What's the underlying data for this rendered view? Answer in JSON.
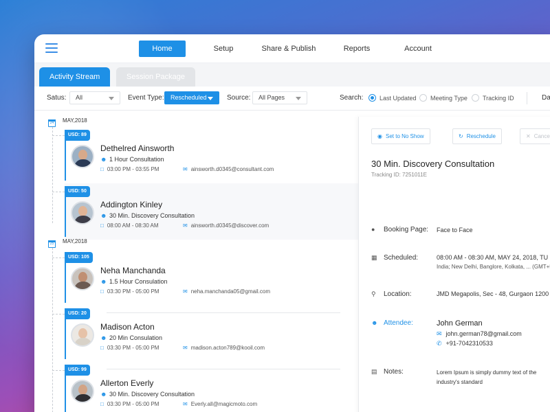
{
  "nav": {
    "items": [
      "Home",
      "Setup",
      "Share & Publish",
      "Reports",
      "Account"
    ],
    "active": "Home"
  },
  "tabs": [
    "Activity Stream",
    "Session Package"
  ],
  "filters": {
    "status_label": "Satus:",
    "status_value": "All",
    "event_type_label": "Event Type:",
    "event_type_value": "Rescheduled",
    "source_label": "Source:",
    "source_value": "All Pages",
    "search_label": "Search:",
    "search_options": [
      "Last Updated",
      "Meeting Type",
      "Tracking ID"
    ],
    "search_selected": "Last Updated",
    "overflow_label": "Da"
  },
  "stream": {
    "groups": [
      {
        "date_icon": "24",
        "date": "MAY,2018",
        "entries": [
          {
            "badge": "USD: 89",
            "name": "Dethelred Ainsworth",
            "service": "1 Hour Consultation",
            "time": "03:00 PM - 03:55 PM",
            "email": "ainsworth.d0345@consultant.com"
          },
          {
            "badge": "USD: 50",
            "name": "Addington Kinley",
            "service": "30 Min. Discovery Consultation",
            "time": "08:00 AM - 08:30 AM",
            "email": "ainsworth.d0345@discover.com"
          }
        ]
      },
      {
        "date_icon": "25",
        "date": "MAY,2018",
        "entries": [
          {
            "badge": "USD: 105",
            "name": "Neha Manchanda",
            "service": "1.5 Hour Consulation",
            "time": "03:30 PM - 05:00 PM",
            "email": "neha.manchanda05@gmail.com"
          },
          {
            "badge": "USD: 20",
            "name": "Madison Acton",
            "service": "20 Min Consulation",
            "time": "03:30 PM - 05:00 PM",
            "email": "madison.acton789@kooil.com"
          },
          {
            "badge": "USD: 99",
            "name": "Allerton Everly",
            "service": "30 Min. Discovery Consultation",
            "time": "03:30 PM - 05:00 PM",
            "email": "Everly.all@magicmoto.com"
          }
        ]
      }
    ]
  },
  "detail": {
    "buttons": {
      "no_show": "Set to No Show",
      "reschedule": "Reschedule",
      "cancel": "Cance"
    },
    "title": "30 Min. Discovery Consultation",
    "tracking": "Tracking ID: 7251011E",
    "booking_label": "Booking Page:",
    "booking_value": "Face to Face",
    "scheduled_label": "Scheduled:",
    "scheduled_value": "08:00 AM - 08:30 AM, MAY 24, 2018, TU",
    "scheduled_sub": "India; New Delhi, Banglore, Kolkata, ... (GMT+5",
    "location_label": "Location:",
    "location_value": "JMD Megapolis, Sec - 48, Gurgaon 1200",
    "attendee_label": "Attendee:",
    "attendee_name": "John German",
    "attendee_email": "john.german78@gmail.com",
    "attendee_phone": "+91-7042310533",
    "notes_label": "Notes:",
    "notes_value": "Lorem Ipsum is simply dummy text of the industry's standard"
  },
  "colors": {
    "accent": "#1e90e6",
    "text": "#222222",
    "muted": "#888888"
  }
}
